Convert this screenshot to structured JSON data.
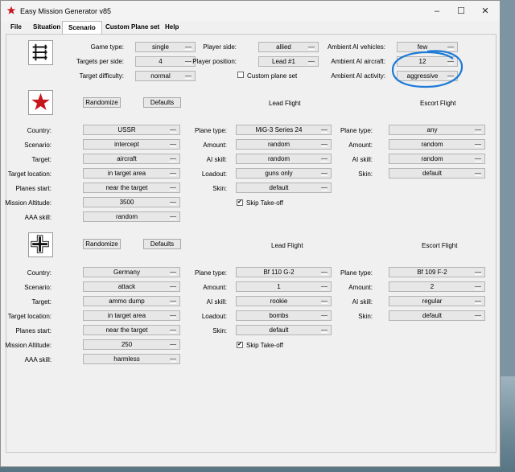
{
  "window": {
    "title": "Easy Mission Generator v85",
    "minimize": "–",
    "maximize": "☐",
    "close": "✕"
  },
  "menu": [
    "File",
    "Situation",
    "Scenario",
    "Custom Plane set",
    "Help"
  ],
  "general": {
    "game_type_label": "Game type:",
    "game_type": "single",
    "targets_label": "Targets per side:",
    "targets": "4",
    "difficulty_label": "Target difficulty:",
    "difficulty": "normal",
    "player_side_label": "Player side:",
    "player_side": "allied",
    "player_position_label": "Player position:",
    "player_position": "Lead #1",
    "custom_plane_label": "Custom plane set",
    "amb_vehicles_label": "Ambient AI vehicles:",
    "amb_vehicles": "few",
    "amb_aircraft_label": "Ambient AI aircraft:",
    "amb_aircraft": "12",
    "amb_activity_label": "Ambient AI activity:",
    "amb_activity": "aggressive"
  },
  "labels": {
    "randomize": "Randomize",
    "defaults": "Defaults",
    "lead": "Lead Flight",
    "escort": "Escort Flight",
    "country": "Country:",
    "scenario": "Scenario:",
    "target": "Target:",
    "target_location": "Target location:",
    "planes_start": "Planes start:",
    "altitude": "Mission Altitude:",
    "aaa": "AAA skill:",
    "plane_type": "Plane type:",
    "amount": "Amount:",
    "ai_skill": "AI skill:",
    "loadout": "Loadout:",
    "skin": "Skin:",
    "skip_takeoff": "Skip Take-off"
  },
  "allied": {
    "country": "USSR",
    "scenario": "intercept",
    "target": "aircraft",
    "target_location": "in target area",
    "planes_start": "near the target",
    "altitude": "3500",
    "aaa": "random",
    "lead": {
      "plane": "MiG-3 Series 24",
      "amount": "random",
      "ai_skill": "random",
      "loadout": "guns only",
      "skin": "default"
    },
    "escort": {
      "plane": "any",
      "amount": "random",
      "ai_skill": "random",
      "skin": "default"
    }
  },
  "axis": {
    "country": "Germany",
    "scenario": "attack",
    "target": "ammo dump",
    "target_location": "in target area",
    "planes_start": "near the target",
    "altitude": "250",
    "aaa": "harmless",
    "lead": {
      "plane": "Bf 110 G-2",
      "amount": "1",
      "ai_skill": "rookie",
      "loadout": "bombs",
      "skin": "default"
    },
    "escort": {
      "plane": "Bf 109 F-2",
      "amount": "2",
      "ai_skill": "regular",
      "skin": "default"
    }
  },
  "colors": {
    "soviet_star": "#c8161d",
    "lasso": "#1c7ad6",
    "balkenkreuz": "#111111"
  }
}
